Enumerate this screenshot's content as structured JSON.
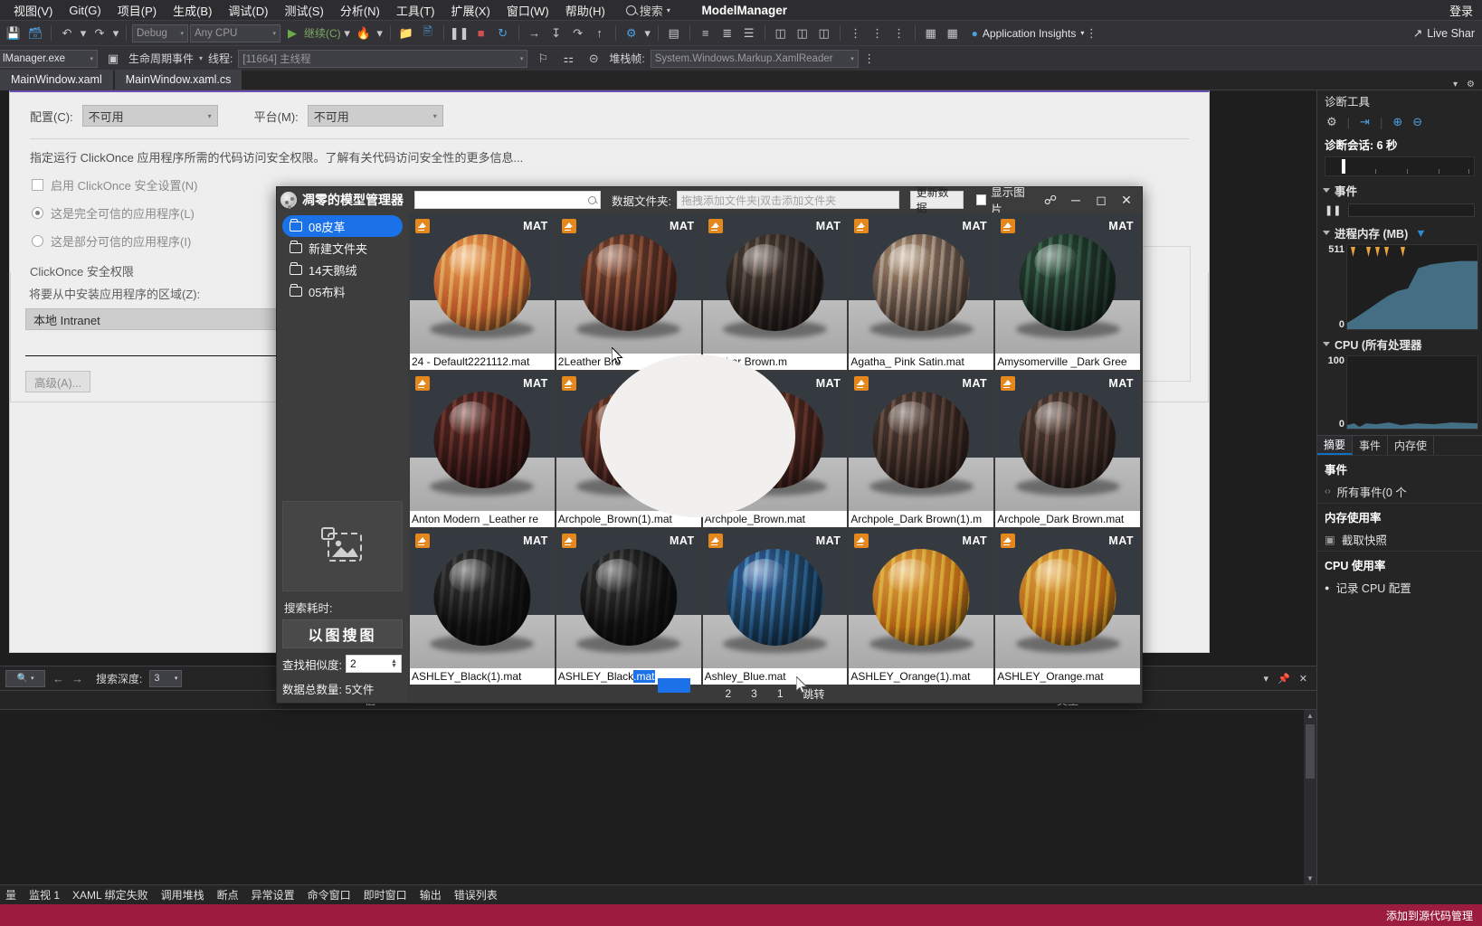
{
  "ide": {
    "title": "ModelManager",
    "menu": [
      "视图(V)",
      "Git(G)",
      "项目(P)",
      "生成(B)",
      "调试(D)",
      "测试(S)",
      "分析(N)",
      "工具(T)",
      "扩展(X)",
      "窗口(W)",
      "帮助(H)"
    ],
    "search_label": "搜索",
    "account_label": "登录",
    "live_share": "Live Shar",
    "toolbar": {
      "config": "Debug",
      "platform": "Any CPU",
      "continue": "继续(C)",
      "app_insights": "Application Insights"
    },
    "debugbar": {
      "process": "lManager.exe",
      "lifecycle": "生命周期事件",
      "thread_label": "线程:",
      "thread_value": "[11664] 主线程",
      "stack_label": "堆栈帧:",
      "stack_value": "System.Windows.Markup.XamlReader"
    },
    "tabs": [
      {
        "label": "MainWindow.xaml",
        "active": false
      },
      {
        "label": "MainWindow.xaml.cs",
        "active": true
      }
    ]
  },
  "designer": {
    "config_label": "配置(C):",
    "config_value": "不可用",
    "platform_label": "平台(M):",
    "platform_value": "不可用",
    "description": "指定运行 ClickOnce 应用程序所需的代码访问安全权限。了解有关代码访问安全性的更多信息...",
    "enable_checkbox": "启用 ClickOnce 安全设置(N)",
    "radio_full": "这是完全可信的应用程序(L)",
    "radio_partial": "这是部分可信的应用程序(I)",
    "group_title": "ClickOnce 安全权限",
    "zone_label": "将要从中安装应用程序的区域(Z):",
    "zone_value": "本地 Intranet",
    "advanced_button": "高级(A)..."
  },
  "bottom_window": {
    "search_placeholder": "",
    "depth_label": "搜索深度:",
    "depth_value": "3",
    "columns": [
      "",
      "值",
      "类型"
    ],
    "tabs": [
      "监视 1",
      "XAML 绑定失败",
      "调用堆栈",
      "断点",
      "异常设置",
      "命令窗口",
      "即时窗口",
      "输出",
      "错误列表"
    ],
    "left_edge_label": "量"
  },
  "status_bar": {
    "right_text": "添加到源代码管理"
  },
  "diagnostics": {
    "title": "诊断工具",
    "session": "诊断会话: 6 秒",
    "events_section": "事件",
    "memory_section": "进程内存 (MB)",
    "memory_max": "511",
    "memory_min": "0",
    "cpu_section": "CPU (所有处理器",
    "cpu_max": "100",
    "cpu_min": "0",
    "tabs": [
      "摘要",
      "事件",
      "内存使"
    ],
    "rows": [
      {
        "header": "事件"
      },
      {
        "item": "所有事件(0 个"
      },
      {
        "header": "内存使用率"
      },
      {
        "item": "截取快照"
      },
      {
        "header": "CPU 使用率"
      },
      {
        "item": "记录 CPU 配置"
      }
    ]
  },
  "model_manager": {
    "title": "凋零的模型管理器",
    "search_value": "",
    "folder_label": "数据文件夹:",
    "folder_placeholder": "拖拽添加文件夹|双击添加文件夹",
    "update_button": "更新数据",
    "show_images_label": "显示图片",
    "show_images_checked": false,
    "window_buttons": [
      "pin-icon",
      "minimize-icon",
      "maximize-icon",
      "close-icon"
    ],
    "sidebar": {
      "folders": [
        {
          "label": "08皮革",
          "selected": true
        },
        {
          "label": "新建文件夹",
          "selected": false
        },
        {
          "label": "14天鹅绒",
          "selected": false
        },
        {
          "label": "05布料",
          "selected": false
        }
      ],
      "elapsed_label": "搜索耗时:",
      "search_by_image_button": "以图搜图",
      "similarity_label": "查找相似度:",
      "similarity_value": "2",
      "total_label": "数据总数量: 5文件"
    },
    "items": [
      {
        "name": "24 - Default2221112.mat",
        "badge": "MAT",
        "color": "#c5793a",
        "hi": "#f0b36a"
      },
      {
        "name": "2Leather Bro",
        "badge": "MAT",
        "color": "#5a2f24",
        "hi": "#9c5f42"
      },
      {
        "name": "Leather Brown.m",
        "badge": "MAT",
        "color": "#2b2320",
        "hi": "#6d5c50"
      },
      {
        "name": "Agatha_ Pink Satin.mat",
        "badge": "MAT",
        "color": "#6e5c4f",
        "hi": "#c9b49f"
      },
      {
        "name": "Amysomerville _Dark Gree",
        "badge": "MAT",
        "color": "#1e3228",
        "hi": "#3f6a52"
      },
      {
        "name": "Anton Modern _Leather re",
        "badge": "MAT",
        "color": "#3a1a18",
        "hi": "#7a3a32"
      },
      {
        "name": "Archpole_Brown(1).mat",
        "badge": "MAT",
        "color": "#4a2620",
        "hi": "#8a4d38"
      },
      {
        "name": "Archpole_Brown.mat",
        "badge": "MAT",
        "color": "#4a2620",
        "hi": "#8a4d38"
      },
      {
        "name": "Archpole_Dark Brown(1).m",
        "badge": "MAT",
        "color": "#3a2a24",
        "hi": "#6f564a"
      },
      {
        "name": "Archpole_Dark Brown.mat",
        "badge": "MAT",
        "color": "#3a2a24",
        "hi": "#6f564a"
      },
      {
        "name": "ASHLEY_Black(1).mat",
        "badge": "MAT",
        "color": "#121212",
        "hi": "#4a4a4a"
      },
      {
        "name": "ASHLEY_Black.mat",
        "badge": "MAT",
        "color": "#121212",
        "hi": "#4a4a4a"
      },
      {
        "name": "Ashley_Blue.mat",
        "badge": "MAT",
        "color": "#1d4568",
        "hi": "#4a86bb"
      },
      {
        "name": "ASHLEY_Orange(1).mat",
        "badge": "MAT",
        "color": "#c2861f",
        "hi": "#e8b856"
      },
      {
        "name": "ASHLEY_Orange.mat",
        "badge": "MAT",
        "color": "#c2861f",
        "hi": "#e8b856"
      }
    ],
    "pager": [
      "2",
      "3",
      "1",
      "跳转"
    ]
  },
  "colors": {
    "accent_blue": "#1b72e8",
    "status_bar": "#9b1c3c",
    "badge_orange": "#e4871c",
    "designer_top": "#6a4fb5"
  }
}
